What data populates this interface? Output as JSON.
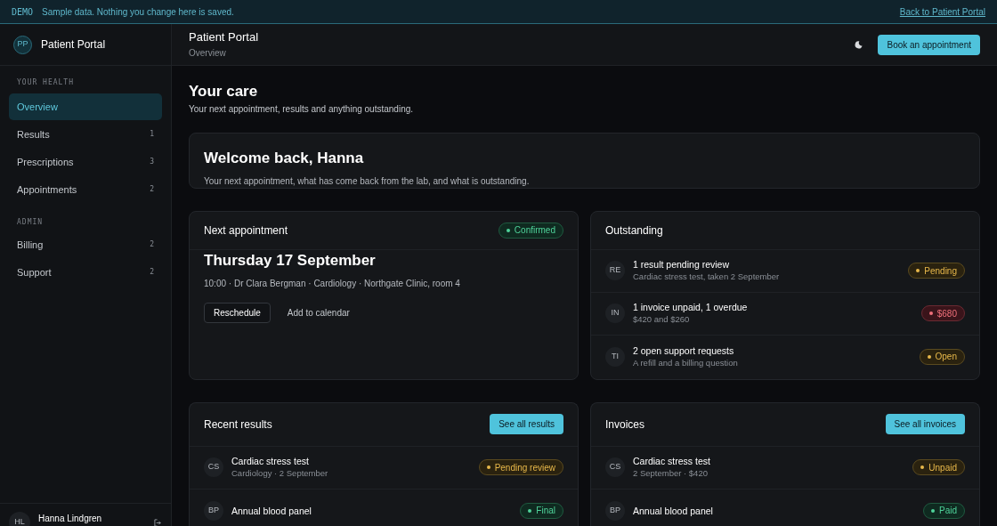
{
  "demo_banner": {
    "tag": "DEMO",
    "message": "Sample data. Nothing you change here is saved.",
    "link": "Back to Patient Portal"
  },
  "sidebar": {
    "logo": "PP",
    "app_name": "Patient Portal",
    "sections": [
      {
        "heading": "YOUR HEALTH",
        "items": [
          {
            "label": "Overview",
            "selected": true
          },
          {
            "label": "Results",
            "count": "1",
            "selected": false
          },
          {
            "label": "Prescriptions",
            "count": "3",
            "selected": false
          },
          {
            "label": "Appointments",
            "count": "2",
            "selected": false
          }
        ]
      },
      {
        "heading": "ADMIN",
        "items": [
          {
            "label": "Billing",
            "count": "2",
            "selected": false
          },
          {
            "label": "Support",
            "count": "2",
            "selected": false
          }
        ]
      }
    ],
    "user": {
      "initials": "HL",
      "name": "Hanna Lindgren"
    }
  },
  "header": {
    "title": "Patient Portal",
    "breadcrumb": "Overview",
    "action": "Book an appointment"
  },
  "page": {
    "title": "Your care",
    "subtitle": "Your next appointment, results and anything outstanding."
  },
  "welcome": {
    "title": "Welcome back, Hanna",
    "text": "Your next appointment, what has come back from the lab, and what is outstanding."
  },
  "next_appointment": {
    "title": "Next appointment",
    "status": {
      "label": "Confirmed",
      "color": "#4fd39a"
    },
    "date": "Thursday 17 September",
    "details": "10:00 · Dr Clara Bergman · Cardiology · Northgate Clinic, room 4",
    "primary_action": "Reschedule",
    "secondary_action": "Add to calendar"
  },
  "outstanding": {
    "title": "Outstanding",
    "items": [
      {
        "initials": "RE",
        "title": "1 result pending review",
        "subtitle": "Cardiac stress test, taken 2 September",
        "status": {
          "label": "Pending",
          "color": "#e8b84a"
        }
      },
      {
        "initials": "IN",
        "title": "1 invoice unpaid, 1 overdue",
        "subtitle": "$420 and $260",
        "status": {
          "label": "$680",
          "color": "#f0707a"
        }
      },
      {
        "initials": "TI",
        "title": "2 open support requests",
        "subtitle": "A refill and a billing question",
        "status": {
          "label": "Open",
          "color": "#e8b84a"
        }
      }
    ]
  },
  "lists": [
    {
      "title": "Recent results",
      "action": "See all results",
      "items": [
        {
          "initials": "CS",
          "title": "Cardiac stress test",
          "subtitle": "Cardiology · 2 September",
          "status": {
            "label": "Pending review",
            "color": "#e8b84a"
          }
        },
        {
          "initials": "BP",
          "title": "Annual blood panel",
          "status": {
            "label": "Final",
            "color": "#4fd39a"
          }
        }
      ]
    },
    {
      "title": "Invoices",
      "action": "See all invoices",
      "items": [
        {
          "initials": "CS",
          "title": "Cardiac stress test",
          "subtitle": "2 September · $420",
          "status": {
            "label": "Unpaid",
            "color": "#e8b84a"
          }
        },
        {
          "initials": "BP",
          "title": "Annual blood panel",
          "status": {
            "label": "Paid",
            "color": "#4fd39a"
          }
        }
      ]
    }
  ]
}
